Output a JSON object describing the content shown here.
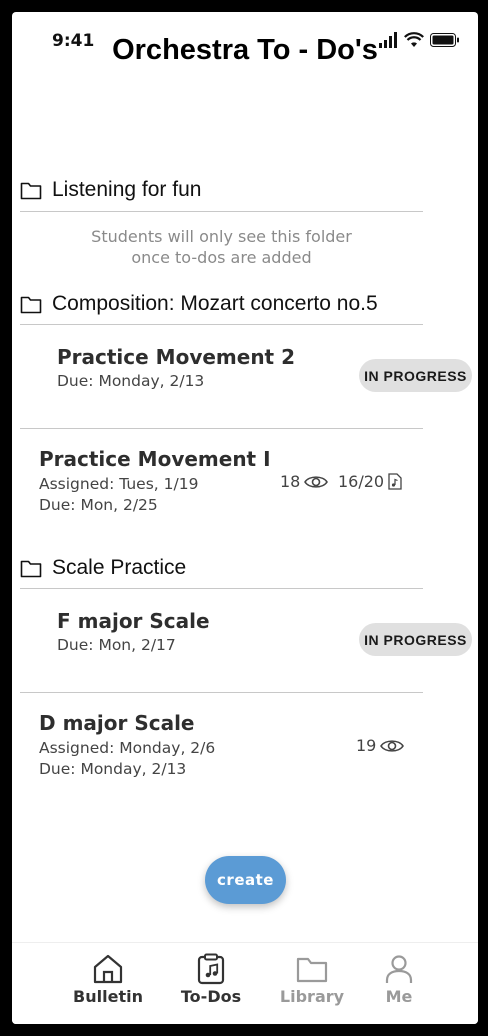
{
  "status_bar": {
    "time": "9:41"
  },
  "app": {
    "title": "Orchestra To - Do's"
  },
  "folders": [
    {
      "name": "Listening for fun",
      "empty_note_line1": "Students will only see this folder",
      "empty_note_line2": "once to-dos are added"
    },
    {
      "name": "Composition: Mozart concerto no.5"
    },
    {
      "name": "Scale Practice"
    }
  ],
  "todos": [
    {
      "title": "Practice Movement 2",
      "due": "Due: Monday, 2/13",
      "badge": "IN PROGRESS"
    },
    {
      "title": "Practice Movement I",
      "assigned": "Assigned: Tues, 1/19",
      "due": "Due: Mon, 2/25",
      "views": "18",
      "submissions": "16/20"
    },
    {
      "title": "F major Scale",
      "due": "Due: Mon, 2/17",
      "badge": "IN PROGRESS"
    },
    {
      "title": "D major Scale",
      "assigned": "Assigned: Monday, 2/6",
      "due": "Due: Monday, 2/13",
      "views": "19"
    }
  ],
  "create_button": {
    "label": "create",
    "color": "#5b9bd5"
  },
  "tabs": [
    {
      "label": "Bulletin",
      "icon": "home-icon",
      "active": false
    },
    {
      "label": "To-Dos",
      "icon": "clipboard-music-icon",
      "active": true
    },
    {
      "label": "Library",
      "icon": "folder-icon",
      "active": false
    },
    {
      "label": "Me",
      "icon": "person-icon",
      "active": false
    }
  ],
  "colors": {
    "tab_active": "#333333",
    "tab_inactive": "#9a9a9a",
    "badge_bg": "#e0e0e0"
  }
}
